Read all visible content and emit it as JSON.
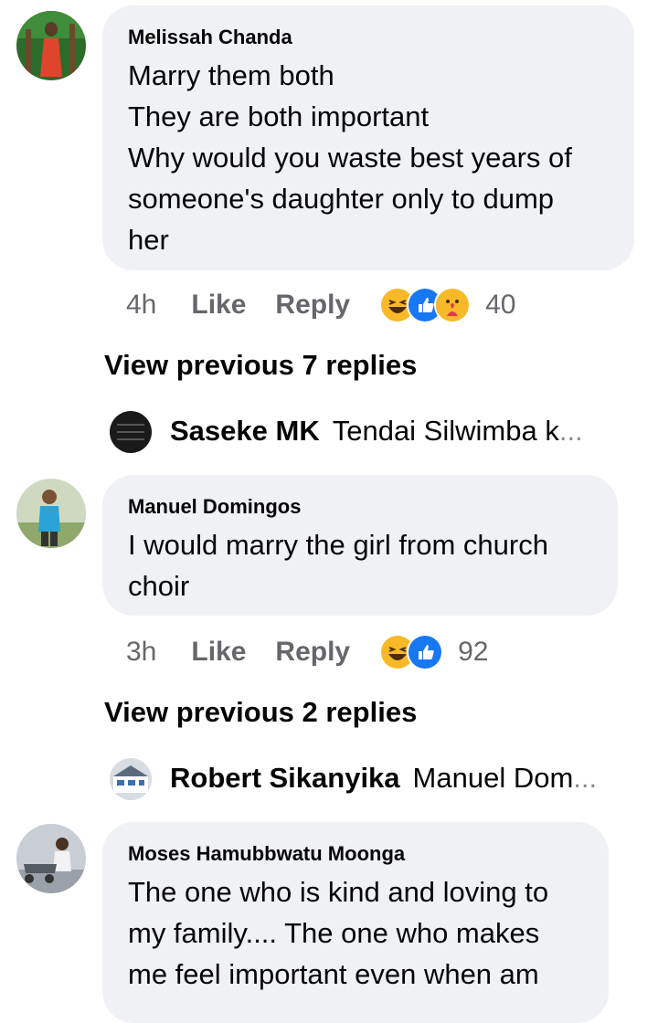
{
  "comments": [
    {
      "author": "Melissah Chanda",
      "text": "Marry them both\nThey are both important\nWhy would you waste best years of\nsomeone's daughter only to dump\nher",
      "time": "4h",
      "like_label": "Like",
      "reply_label": "Reply",
      "reactions": [
        "haha",
        "like",
        "care"
      ],
      "reaction_count": "40",
      "view_replies_label": "View previous 7 replies",
      "latest_reply": {
        "name": "Saseke MK",
        "snippet": "Tendai Silwimba k",
        "ellipsis": "..."
      }
    },
    {
      "author": "Manuel Domingos",
      "text": "I would marry the girl from church\nchoir",
      "time": "3h",
      "like_label": "Like",
      "reply_label": "Reply",
      "reactions": [
        "haha",
        "like"
      ],
      "reaction_count": "92",
      "view_replies_label": "View previous 2 replies",
      "latest_reply": {
        "name": "Robert Sikanyika",
        "snippet": "Manuel Dom",
        "ellipsis": "..."
      }
    },
    {
      "author": "Moses Hamubbwatu Moonga",
      "text": "The one who is kind and loving to\nmy family.... The one who makes\nme feel important even when am"
    }
  ],
  "colors": {
    "bubble": "#eff1f4",
    "meta": "#65676b",
    "like_blue": "#1877f2",
    "haha_yellow": "#f7b928"
  }
}
